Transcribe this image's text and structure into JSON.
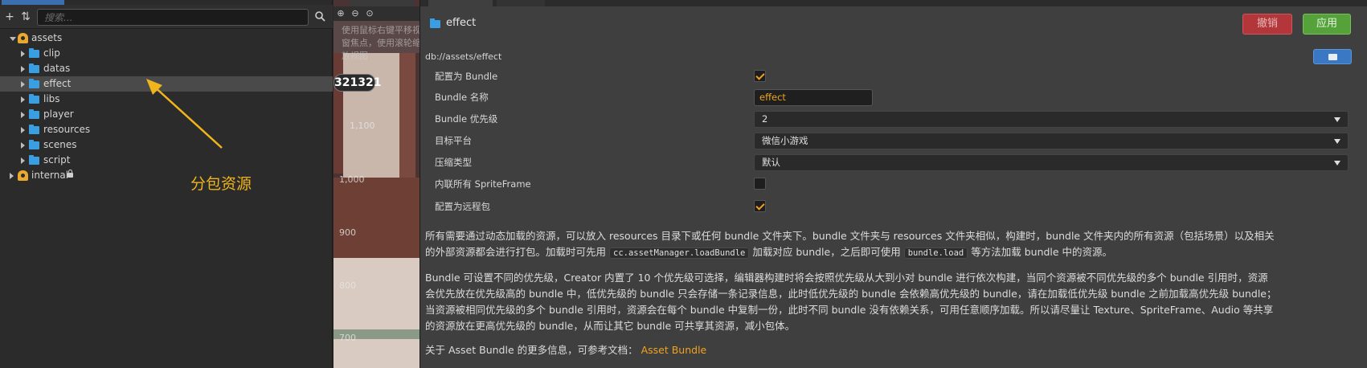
{
  "assets_panel": {
    "search_placeholder": "搜索...",
    "tree": [
      {
        "label": "assets",
        "type": "db",
        "expanded": true,
        "depth": 0
      },
      {
        "label": "clip",
        "type": "folder",
        "depth": 1
      },
      {
        "label": "datas",
        "type": "folder",
        "depth": 1
      },
      {
        "label": "effect",
        "type": "folder",
        "depth": 1,
        "selected": true
      },
      {
        "label": "libs",
        "type": "folder",
        "depth": 1
      },
      {
        "label": "player",
        "type": "folder",
        "depth": 1
      },
      {
        "label": "resources",
        "type": "folder",
        "depth": 1
      },
      {
        "label": "scenes",
        "type": "folder",
        "depth": 1
      },
      {
        "label": "script",
        "type": "folder",
        "depth": 1
      },
      {
        "label": "internal",
        "type": "db",
        "locked": true,
        "depth": 0
      }
    ],
    "annotation": "分包资源"
  },
  "scene": {
    "overlay_text": "使用鼠标右键平移视窗焦点，使用滚轮缩放视图",
    "counter": "321321",
    "ruler_labels": [
      "1,100",
      "1,000",
      "900",
      "800",
      "700"
    ]
  },
  "inspector": {
    "title": "effect",
    "revert_label": "撤销",
    "apply_label": "应用",
    "db_path": "db://assets/effect",
    "properties": {
      "is_bundle": {
        "label": "配置为 Bundle",
        "checked": true
      },
      "bundle_name": {
        "label": "Bundle 名称",
        "value": "effect"
      },
      "bundle_priority": {
        "label": "Bundle 优先级",
        "value": "2"
      },
      "target_platform": {
        "label": "目标平台",
        "value": "微信小游戏"
      },
      "compression_type": {
        "label": "压缩类型",
        "value": "默认"
      },
      "inline_spriteframe": {
        "label": "内联所有 SpriteFrame",
        "checked": false
      },
      "is_remote": {
        "label": "配置为远程包",
        "checked": true
      }
    },
    "description": {
      "p1_a": "所有需要通过动态加载的资源，可以放入 resources 目录下或任何 bundle 文件夹下。bundle 文件夹与 resources 文件夹相似，构建时，bundle 文件夹内的所有资源（包括场景）以及相关",
      "p1_b": "的外部资源都会进行打包。加载时可先用",
      "p1_code1": "cc.assetManager.loadBundle",
      "p1_c": "加载对应 bundle，之后即可使用",
      "p1_code2": "bundle.load",
      "p1_d": "等方法加载 bundle 中的资源。",
      "p2_l1": "Bundle 可设置不同的优先级，Creator 内置了 10 个优先级可选择，编辑器构建时将会按照优先级从大到小对 bundle 进行依次构建，当同个资源被不同优先级的多个 bundle 引用时，资源",
      "p2_l2": "会优先放在优先级高的 bundle 中，低优先级的 bundle 只会存储一条记录信息，此时低优先级的 bundle 会依赖高优先级的 bundle，请在加载低优先级 bundle 之前加载高优先级 bundle；",
      "p2_l3": "当资源被相同优先级的多个 bundle 引用时，资源会在每个 bundle 中复制一份，此时不同 bundle 没有依赖关系，可用任意顺序加载。所以请尽量让 Texture、SpriteFrame、Audio 等共享",
      "p2_l4": "的资源放在更高优先级的 bundle，从而让其它 bundle 可共享其资源，减小包体。",
      "p3": "关于 Asset Bundle 的更多信息，可参考文档：",
      "p3_link": "Asset Bundle"
    }
  },
  "colors": {
    "accent": "#f0a21f",
    "folder": "#3a9ee3",
    "revert": "#b3363a",
    "apply": "#55a23a"
  }
}
